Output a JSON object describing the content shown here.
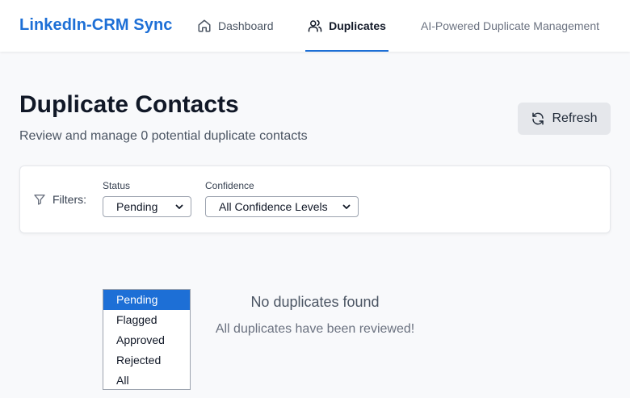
{
  "header": {
    "brand": "LinkedIn-CRM Sync",
    "nav": [
      {
        "label": "Dashboard",
        "icon": "home-icon"
      },
      {
        "label": "Duplicates",
        "icon": "users-icon",
        "active": true
      }
    ],
    "tagline": "AI-Powered Duplicate Management"
  },
  "page": {
    "title": "Duplicate Contacts",
    "subtitle": "Review and manage 0 potential duplicate contacts",
    "refresh_label": "Refresh",
    "refresh_icon": "refresh-icon"
  },
  "filters": {
    "label": "Filters:",
    "icon": "filter-icon",
    "status": {
      "label": "Status",
      "selected": "Pending",
      "options": [
        "Pending",
        "Flagged",
        "Approved",
        "Rejected",
        "All"
      ]
    },
    "confidence": {
      "label": "Confidence",
      "selected": "All Confidence Levels"
    }
  },
  "empty_state": {
    "title": "No duplicates found",
    "message": "All duplicates have been reviewed!"
  },
  "colors": {
    "accent": "#1d6fd6",
    "background": "#f8f9fb",
    "button_bg": "#e5e7eb"
  }
}
